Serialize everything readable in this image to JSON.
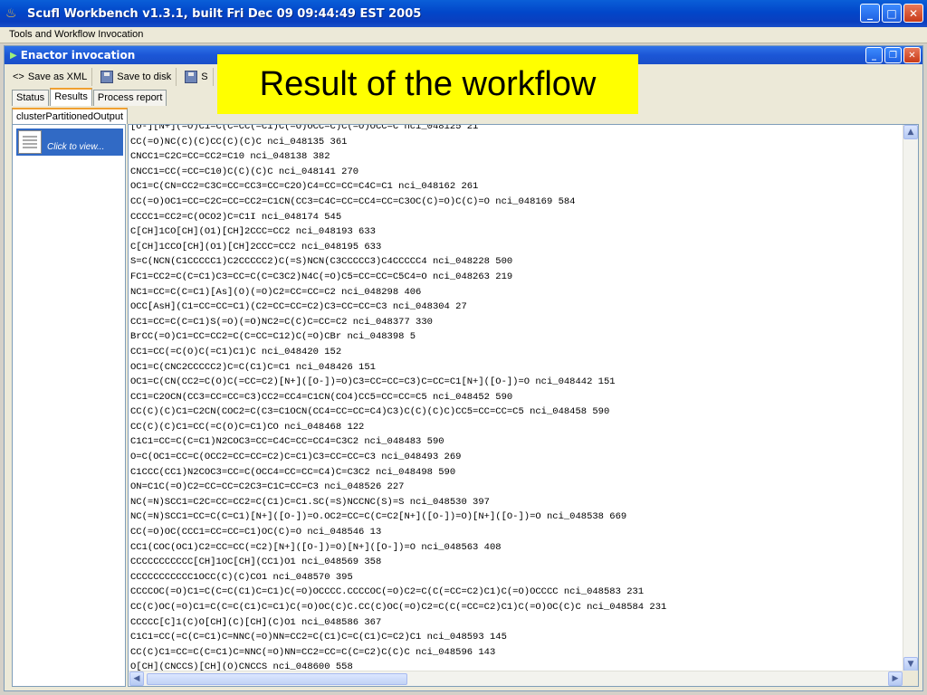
{
  "window": {
    "title": "Scufl Workbench v1.3.1, built Fri Dec 09 09:44:49 EST 2005"
  },
  "menubar": {
    "label": "Tools and Workflow Invocation"
  },
  "inner_window": {
    "title": "Enactor invocation"
  },
  "toolbar": {
    "save_xml": "Save as XML",
    "save_disk": "Save to disk",
    "save_other": "S"
  },
  "tabs": [
    "Status",
    "Results",
    "Process report"
  ],
  "active_tab": "Results",
  "output_tab": "clusterPartitionedOutput",
  "left_item": {
    "label": "Click to view..."
  },
  "banner": "Result of the workflow",
  "output_lines": [
    "[O-][N+](=O)C1=C(C=CC(=C1)C(=O)OCC=C)C(=O)OCC=C nci_048125 21",
    "CC(=O)NC(C)(C)CC(C)(C)C nci_048135 361",
    "CNCC1=C2C=CC=CC2=C10 nci_048138 382",
    "CNCC1=CC(=CC=C10)C(C)(C)C nci_048141 270",
    "OC1=C(CN=CC2=C3C=CC=CC3=CC=C2O)C4=CC=CC=C4C=C1 nci_048162 261",
    "CC(=O)OC1=CC=C2C=CC=CC2=C1CN(CC3=C4C=CC=CC4=CC=C3OC(C)=O)C(C)=O nci_048169 584",
    "CCCC1=CC2=C(OCO2)C=C1I nci_048174 545",
    "C[CH]1CO[CH](O1)[CH]2CCC=CC2 nci_048193 633",
    "C[CH]1CCO[CH](O1)[CH]2CCC=CC2 nci_048195 633",
    "S=C(NCN(C1CCCCC1)C2CCCCC2)C(=S)NCN(C3CCCCC3)C4CCCCC4 nci_048228 500",
    "FC1=CC2=C(C=C1)C3=CC=C(C=C3C2)N4C(=O)C5=CC=CC=C5C4=O nci_048263 219",
    "NC1=CC=C(C=C1)[As](O)(=O)C2=CC=CC=C2 nci_048298 406",
    "OCC[AsH](C1=CC=CC=C1)(C2=CC=CC=C2)C3=CC=CC=C3 nci_048304 27",
    "CC1=CC=C(C=C1)S(=O)(=O)NC2=C(C)C=CC=C2 nci_048377 330",
    "BrCC(=O)C1=CC=CC2=C(C=CC=C12)C(=O)CBr nci_048398 5",
    "CC1=CC(=C(O)C(=C1)C1)C nci_048420 152",
    "OC1=C(CNC2CCCCC2)C=C(C1)C=C1 nci_048426 151",
    "OC1=C(CN(CC2=C(O)C(=CC=C2)[N+]([O-])=O)C3=CC=CC=C3)C=CC=C1[N+]([O-])=O nci_048442 151",
    "CC1=C2OCN(CC3=CC=CC=C3)CC2=CC4=C1CN(CO4)CC5=CC=CC=C5 nci_048452 590",
    "CC(C)(C)C1=C2CN(COC2=C(C3=C1OCN(CC4=CC=CC=C4)C3)C(C)(C)C)CC5=CC=CC=C5 nci_048458 590",
    "CC(C)(C)C1=CC(=C(O)C=C1)CO nci_048468 122",
    "C1C1=CC=C(C=C1)N2COC3=CC=C4C=CC=CC4=C3C2 nci_048483 590",
    "O=C(OC1=CC=C(OCC2=CC=CC=C2)C=C1)C3=CC=CC=C3 nci_048493 269",
    "C1CCC(CC1)N2COC3=CC=C(OCC4=CC=CC=C4)C=C3C2 nci_048498 590",
    "ON=C1C(=O)C2=CC=CC=C2C3=C1C=CC=C3 nci_048526 227",
    "NC(=N)SCC1=C2C=CC=CC2=C(C1)C=C1.SC(=S)NCCNC(S)=S nci_048530 397",
    "NC(=N)SCC1=CC=C(C=C1)[N+]([O-])=O.OC2=CC=C(C=C2[N+]([O-])=O)[N+]([O-])=O nci_048538 669",
    "CC(=O)OC(CCC1=CC=CC=C1)OC(C)=O nci_048546 13",
    "CC1(COC(OC1)C2=CC=CC(=C2)[N+]([O-])=O)[N+]([O-])=O nci_048563 408",
    "CCCCCCCCCCC[CH]1OC[CH](CC1)O1 nci_048569 358",
    "CCCCCCCCCCC1OCC(C)(C)CO1 nci_048570 395",
    "CCCCOC(=O)C1=C(C=C(C1)C=C1)C(=O)OCCCC.CCCCOC(=O)C2=C(C(=CC=C2)C1)C(=O)OCCCC nci_048583 231",
    "CC(C)OC(=O)C1=C(C=C(C1)C=C1)C(=O)OC(C)C.CC(C)OC(=O)C2=C(C(=CC=C2)C1)C(=O)OC(C)C nci_048584 231",
    "CCCCC[C]1(C)O[CH](C)[CH](C)O1 nci_048586 367",
    "C1C1=CC(=C(C=C1)C=NNC(=O)NN=CC2=C(C1)C=C(C1)C=C2)C1 nci_048593 145",
    "CC(C)C1=CC=C(C=C1)C=NNC(=O)NN=CC2=CC=C(C=C2)C(C)C nci_048596 143",
    "O[CH](CNCCS)[CH](O)CNCCS nci_048600 558"
  ]
}
